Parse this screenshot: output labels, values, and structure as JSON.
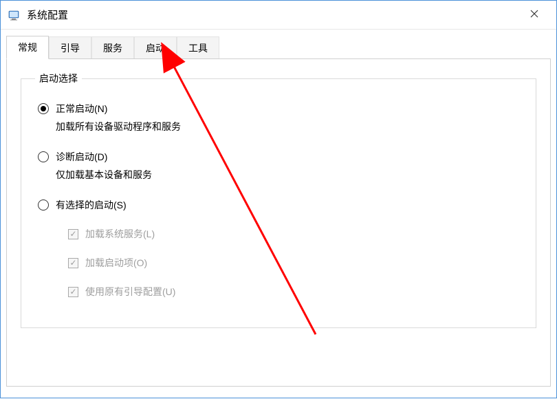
{
  "window": {
    "title": "系统配置",
    "close_tooltip": "关闭"
  },
  "tabs": [
    {
      "label": "常规",
      "active": true
    },
    {
      "label": "引导",
      "active": false
    },
    {
      "label": "服务",
      "active": false
    },
    {
      "label": "启动",
      "active": false
    },
    {
      "label": "工具",
      "active": false
    }
  ],
  "group": {
    "legend": "启动选择",
    "radios": [
      {
        "label": "正常启动(N)",
        "desc": "加载所有设备驱动程序和服务",
        "selected": true
      },
      {
        "label": "诊断启动(D)",
        "desc": "仅加载基本设备和服务",
        "selected": false
      },
      {
        "label": "有选择的启动(S)",
        "desc": "",
        "selected": false
      }
    ],
    "checkboxes": [
      {
        "label": "加载系统服务(L)",
        "checked": true,
        "disabled": true
      },
      {
        "label": "加载启动项(O)",
        "checked": true,
        "disabled": true
      },
      {
        "label": "使用原有引导配置(U)",
        "checked": true,
        "disabled": true
      }
    ]
  }
}
